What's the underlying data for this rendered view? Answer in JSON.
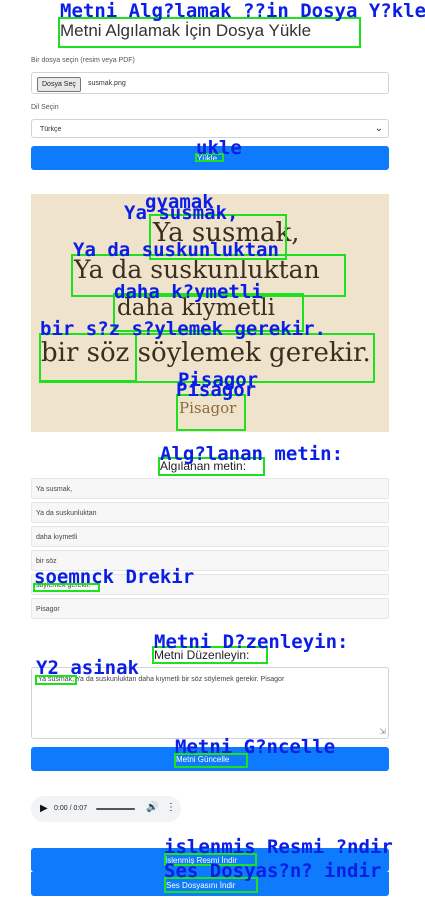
{
  "header": {
    "title": "Metni Algılamak İçin Dosya Yükle",
    "title_overlay": "Metni Alg?lamak ??in Dosya Y?kle"
  },
  "file": {
    "label": "Bir dosya seçin (resim veya PDF)",
    "button": "Dosya Seç",
    "filename": "susmak.png"
  },
  "language": {
    "label": "Dil Seçin",
    "selected": "Türkçe"
  },
  "upload_button": {
    "label": "Yükle",
    "overlay": "ukle"
  },
  "image": {
    "lines": [
      "Ya susmak,",
      "Ya da suskunluktan",
      "daha kıymetli",
      "bir söz söylemek gerekir.",
      "Pisagor"
    ],
    "overlays": [
      "gyamak",
      "Ya susmak,",
      "Ya da suskunluktan",
      "daha k?ymetli",
      "bir s?z s?ylemek gerekir.",
      "Pisagor",
      "Pisagor"
    ]
  },
  "detected": {
    "heading": "Algılanan metin:",
    "heading_overlay": "Alg?lanan metin:",
    "lines": [
      "Ya susmak,",
      "Ya da suskunluktan",
      "daha kıymetli",
      "bir söz",
      "söylemek gerekir.",
      "Pisagor"
    ],
    "line5_overlay": "soemnck Drekir"
  },
  "edit": {
    "heading": "Metni Düzenleyin:",
    "heading_overlay": "Metni D?zenleyin:",
    "text": "Ya susmak, Ya da suskunluktan daha kıymetli bir söz söylemek gerekir. Pisagor",
    "overlay": "Y2 asinak"
  },
  "update_button": {
    "label": "Metni Güncelle",
    "overlay": "Metni G?ncelle"
  },
  "audio": {
    "time": "0:00 / 0:07"
  },
  "download_image": {
    "label": "İşlenmiş Resmi İndir",
    "overlay": "islenmis Resmi ?ndir"
  },
  "download_audio": {
    "label": "Ses Dosyasını İndir",
    "overlay": "Ses Dosyas?n? indir"
  },
  "colors": {
    "primary": "#0d7bfb",
    "box": "#1ee01e",
    "overlay_text": "#0a1ee6"
  }
}
